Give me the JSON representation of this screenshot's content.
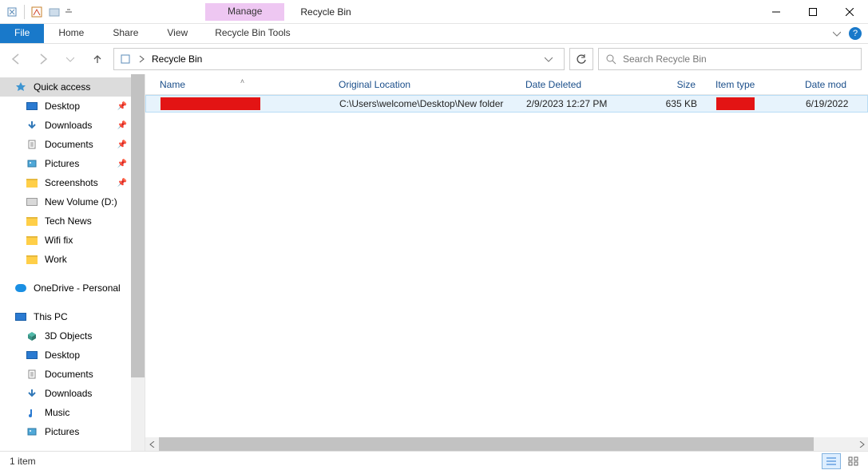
{
  "title": "Recycle Bin",
  "context_tab": "Manage",
  "tabs": {
    "file": "File",
    "home": "Home",
    "share": "Share",
    "view": "View",
    "tool": "Recycle Bin Tools"
  },
  "breadcrumb": {
    "location": "Recycle Bin"
  },
  "search": {
    "placeholder": "Search Recycle Bin"
  },
  "columns": {
    "name": "Name",
    "orig": "Original Location",
    "del": "Date Deleted",
    "size": "Size",
    "type": "Item type",
    "mod": "Date mod"
  },
  "rows": [
    {
      "name": "",
      "orig": "C:\\Users\\welcome\\Desktop\\New folder",
      "del": "2/9/2023 12:27 PM",
      "size": "635 KB",
      "type": "",
      "mod": "6/19/2022"
    }
  ],
  "sidebar": {
    "quick_access": "Quick access",
    "qa_items": [
      {
        "label": "Desktop",
        "icon": "desktop",
        "pinned": true
      },
      {
        "label": "Downloads",
        "icon": "downloads",
        "pinned": true
      },
      {
        "label": "Documents",
        "icon": "documents",
        "pinned": true
      },
      {
        "label": "Pictures",
        "icon": "pictures",
        "pinned": true
      },
      {
        "label": "Screenshots",
        "icon": "folder",
        "pinned": true
      },
      {
        "label": "New Volume (D:)",
        "icon": "drive",
        "pinned": false
      },
      {
        "label": "Tech News",
        "icon": "folder",
        "pinned": false
      },
      {
        "label": "Wifi fix",
        "icon": "folder",
        "pinned": false
      },
      {
        "label": "Work",
        "icon": "folder",
        "pinned": false
      }
    ],
    "onedrive": "OneDrive - Personal",
    "this_pc": "This PC",
    "pc_items": [
      {
        "label": "3D Objects",
        "icon": "3d"
      },
      {
        "label": "Desktop",
        "icon": "desktop"
      },
      {
        "label": "Documents",
        "icon": "documents"
      },
      {
        "label": "Downloads",
        "icon": "downloads"
      },
      {
        "label": "Music",
        "icon": "music"
      },
      {
        "label": "Pictures",
        "icon": "pictures"
      }
    ]
  },
  "status": {
    "count": "1 item"
  }
}
